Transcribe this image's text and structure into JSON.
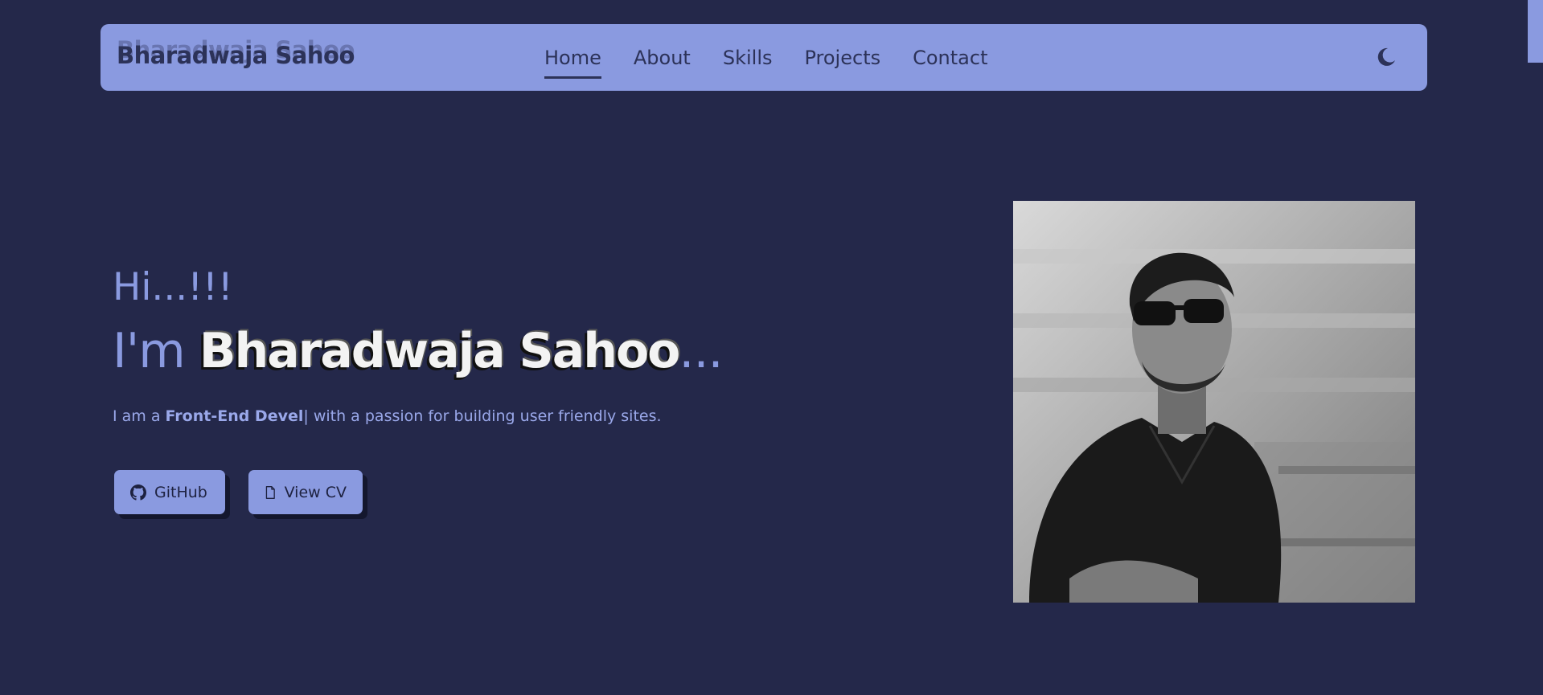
{
  "nav": {
    "brand": "Bharadwaja Sahoo",
    "links": [
      {
        "label": "Home",
        "active": true
      },
      {
        "label": "About"
      },
      {
        "label": "Skills"
      },
      {
        "label": "Projects"
      },
      {
        "label": "Contact"
      }
    ],
    "theme_icon": "moon-icon"
  },
  "hero": {
    "greeting": "Hi...!!!",
    "prefix": "I'm ",
    "name": "Bharadwaja Sahoo",
    "suffix": "...",
    "tagline_prefix": "I am a ",
    "tagline_role": "Front-End Devel",
    "tagline_cursor": "|",
    "tagline_suffix": " with a passion for building user friendly sites.",
    "buttons": [
      {
        "label": "GitHub",
        "icon": "github-icon"
      },
      {
        "label": "View CV",
        "icon": "document-icon"
      }
    ],
    "photo_icon": "profile-photo"
  },
  "colors": {
    "background": "#24284a",
    "accent": "#8a9ae0",
    "dark_text": "#2c3258",
    "name_text": "#f3f3f3"
  }
}
